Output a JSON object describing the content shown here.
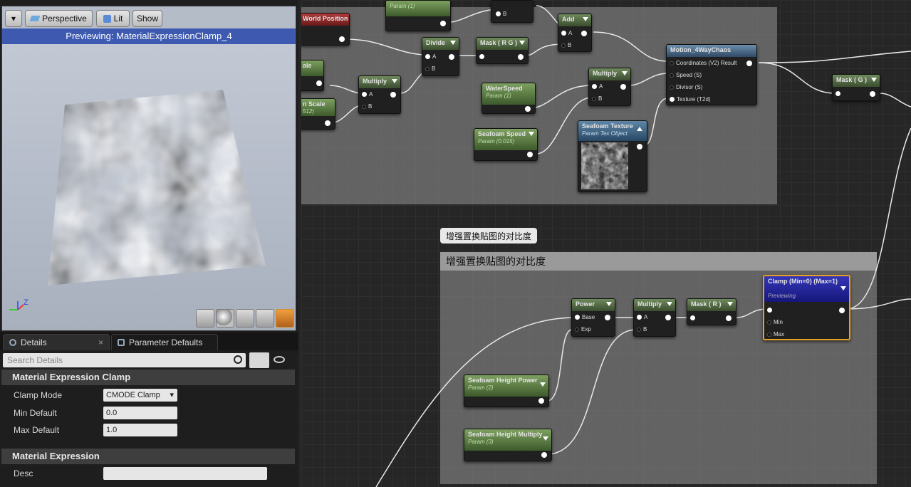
{
  "viewport": {
    "menu_label": "▾",
    "perspective_label": "Perspective",
    "lit_label": "Lit",
    "show_label": "Show",
    "preview_text": "Previewing: MaterialExpressionClamp_4",
    "axis_z": "Z",
    "preview_icons": [
      "cylinder-icon",
      "sphere-icon",
      "plane-icon",
      "cube-icon",
      "teapot-icon"
    ]
  },
  "tabs": {
    "details": "Details",
    "details_close": "×",
    "params": "Parameter Defaults"
  },
  "details": {
    "search_placeholder": "Search Details",
    "section1": "Material Expression Clamp",
    "clamp_mode_label": "Clamp Mode",
    "clamp_mode_value": "CMODE Clamp",
    "min_label": "Min Default",
    "min_value": "0.0",
    "max_label": "Max Default",
    "max_value": "1.0",
    "section2": "Material Expression",
    "desc_label": "Desc",
    "desc_value": ""
  },
  "graph": {
    "comment_tooltip": "增强置换贴图的对比度",
    "comment_title": "增强置换贴图的对比度",
    "nodes": {
      "world_position": {
        "title": "World Position"
      },
      "param_top": {
        "title": "",
        "sub": "Param (1)"
      },
      "b_top": {
        "pin": "B"
      },
      "add": {
        "title": "Add",
        "a": "A",
        "b": "B"
      },
      "divide": {
        "title": "Divide",
        "a": "A",
        "b": "B"
      },
      "mask_rg": {
        "title": "Mask ( R G )"
      },
      "scale": {
        "title": "ale"
      },
      "n_scale": {
        "title": "n Scale",
        "sub": "512)"
      },
      "multiply1": {
        "title": "Multiply",
        "a": "A",
        "b": "B"
      },
      "waterspeed": {
        "title": "WaterSpeed",
        "sub": "Param (1)"
      },
      "multiply2": {
        "title": "Multiply",
        "a": "A",
        "b": "B"
      },
      "motion": {
        "title": "Motion_4WayChaos",
        "p1": "Coordinates (V2) Result",
        "p2": "Speed (S)",
        "p3": "Divisor (S)",
        "p4": "Texture (T2d)"
      },
      "mask_g": {
        "title": "Mask ( G )"
      },
      "seafoam_speed": {
        "title": "Seafoam Speed",
        "sub": "Param (0.015)"
      },
      "seafoam_texture": {
        "title": "Seafoam Texture",
        "sub": "Param Tex Object"
      },
      "power": {
        "title": "Power",
        "base": "Base",
        "exp": "Exp"
      },
      "multiply3": {
        "title": "Multiply",
        "a": "A",
        "b": "B"
      },
      "mask_r": {
        "title": "Mask ( R )"
      },
      "clamp": {
        "title": "Clamp (Min=0) (Max=1)",
        "sub": "Previewing",
        "min": "Min",
        "max": "Max"
      },
      "height_power": {
        "title": "Seafoam Height Power",
        "sub": "Param (2)"
      },
      "height_multiply": {
        "title": "Seafoam Height Multiply",
        "sub": "Param (3)"
      }
    }
  },
  "colors": {
    "preview_bar": "#3d5ab0",
    "clamp_header": "#22239a",
    "clamp_border": "#e8a020"
  }
}
